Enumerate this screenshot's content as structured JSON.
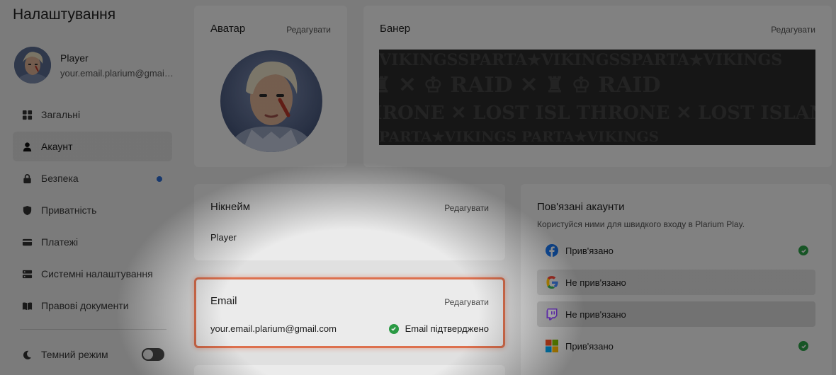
{
  "sidebar": {
    "title": "Налаштування",
    "profile": {
      "name": "Player",
      "email": "your.email.plarium@gmail.com"
    },
    "items": [
      {
        "label": "Загальні",
        "icon": "grid-icon"
      },
      {
        "label": "Акаунт",
        "icon": "user-icon",
        "active": true
      },
      {
        "label": "Безпека",
        "icon": "lock-icon",
        "badge": true
      },
      {
        "label": "Приватність",
        "icon": "shield-icon"
      },
      {
        "label": "Платежі",
        "icon": "card-icon"
      },
      {
        "label": "Системні налаштування",
        "icon": "server-icon"
      },
      {
        "label": "Правові документи",
        "icon": "book-icon"
      }
    ],
    "theme": {
      "label": "Темний режим",
      "icon": "moon-icon",
      "enabled": false
    }
  },
  "avatar_card": {
    "title": "Аватар",
    "edit": "Редагувати"
  },
  "banner_card": {
    "title": "Банер",
    "edit": "Редагувати"
  },
  "nickname_card": {
    "title": "Нікнейм",
    "edit": "Редагувати",
    "value": "Player"
  },
  "email_card": {
    "title": "Email",
    "edit": "Редагувати",
    "value": "your.email.plarium@gmail.com",
    "status": "Email підтверджено"
  },
  "linked_card": {
    "title": "Пов'язані акаунти",
    "subtitle": "Користуйся ними для швидкого входу в Plarium Play.",
    "accounts": [
      {
        "provider": "Facebook",
        "icon": "facebook-icon",
        "status": "Прив'язано",
        "linked": true
      },
      {
        "provider": "Google",
        "icon": "google-icon",
        "status": "Не прив'язано",
        "linked": false
      },
      {
        "provider": "Twitch",
        "icon": "twitch-icon",
        "status": "Не прив'язано",
        "linked": false
      },
      {
        "provider": "Microsoft",
        "icon": "microsoft-icon",
        "status": "Прив'язано",
        "linked": true
      }
    ]
  },
  "colors": {
    "accent_highlight": "#f07a55",
    "verified": "#2ea84a",
    "badge": "#2d6ed8"
  }
}
